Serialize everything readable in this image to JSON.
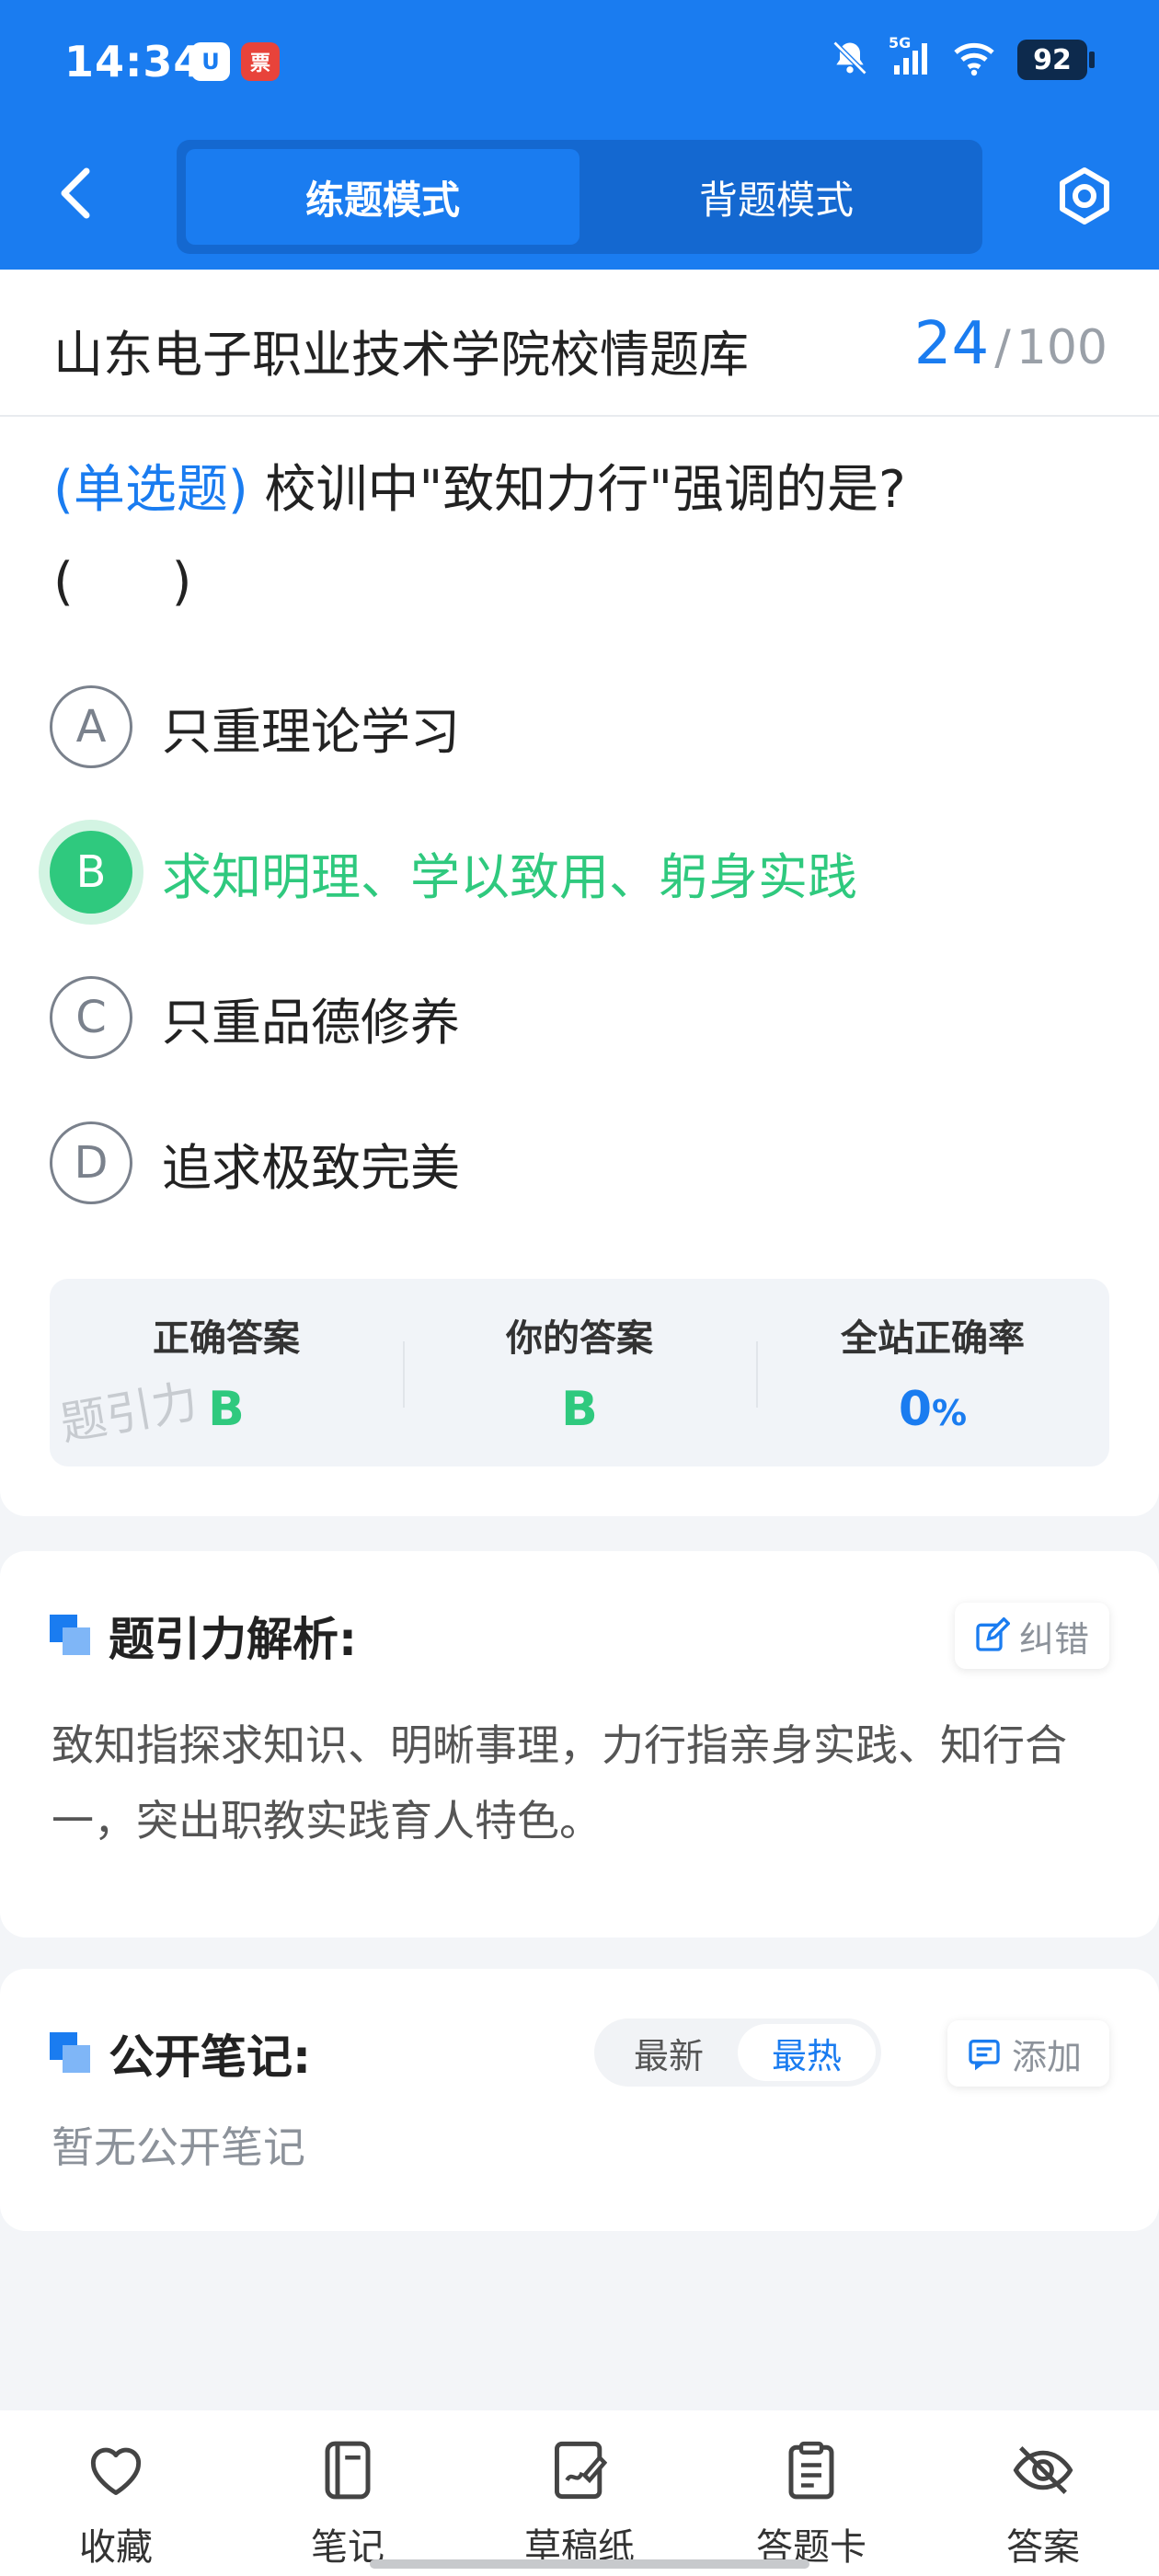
{
  "status_bar": {
    "time": "14:34",
    "app_badge_1": "U",
    "app_badge_2": "票",
    "network": "5G",
    "battery": "92"
  },
  "nav": {
    "modes": [
      "练题模式",
      "背题模式"
    ],
    "active_mode": "练题模式"
  },
  "bank": {
    "title": "山东电子职业技术学院校情题库",
    "current": "24",
    "separator": "/",
    "total": "100"
  },
  "question": {
    "type": "(单选题)",
    "text": "校训中\"致知力行\"强调的是?",
    "blank": "(      )",
    "options": [
      {
        "letter": "A",
        "text": "只重理论学习"
      },
      {
        "letter": "B",
        "text": "求知明理、学以致用、躬身实践"
      },
      {
        "letter": "C",
        "text": "只重品德修养"
      },
      {
        "letter": "D",
        "text": "追求极致完美"
      }
    ],
    "correct_option": "B"
  },
  "result": {
    "correct_label": "正确答案",
    "correct_value": "B",
    "yours_label": "你的答案",
    "yours_value": "B",
    "rate_label": "全站正确率",
    "rate_value": "0",
    "rate_unit": "%",
    "watermark": "题引力"
  },
  "analysis": {
    "title": "题引力解析:",
    "report_label": "纠错",
    "text": "致知指探求知识、明晰事理，力行指亲身实践、知行合一，突出职教实践育人特色。"
  },
  "notes": {
    "title": "公开笔记:",
    "sort_options": [
      "最新",
      "最热"
    ],
    "active_sort": "最热",
    "add_label": "添加",
    "empty_text": "暂无公开笔记"
  },
  "bottom_nav": [
    {
      "label": "收藏",
      "icon": "heart-icon"
    },
    {
      "label": "笔记",
      "icon": "notebook-icon"
    },
    {
      "label": "草稿纸",
      "icon": "draft-paper-icon"
    },
    {
      "label": "答题卡",
      "icon": "answer-sheet-icon"
    },
    {
      "label": "答案",
      "icon": "eye-off-icon"
    }
  ],
  "colors": {
    "primary": "#1a7cf0",
    "correct": "#2fc97e",
    "muted": "#8c929a"
  }
}
